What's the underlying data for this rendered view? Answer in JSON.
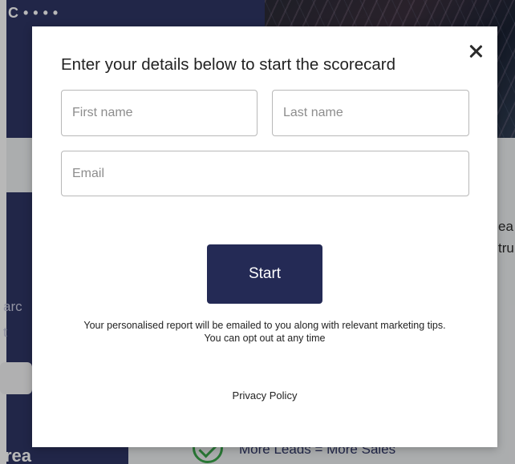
{
  "background": {
    "dots": "C••••",
    "left_fragment_1": "arc",
    "left_fragment_2": "t",
    "right_fragment_1": "ea",
    "right_fragment_2": "tru",
    "brand_fragment": "rea",
    "bullet_text": "More Leads = More Sales"
  },
  "modal": {
    "title": "Enter your details below to start the scorecard",
    "fields": {
      "first_name_placeholder": "First name",
      "last_name_placeholder": "Last name",
      "email_placeholder": "Email"
    },
    "start_label": "Start",
    "notice_line1": "Your personalised report will be emailed to you along with relevant marketing tips.",
    "notice_line2": "You can opt out at any time",
    "privacy_label": "Privacy Policy"
  },
  "colors": {
    "primary_button": "#242a55",
    "background_navy": "#2e3565",
    "check_green": "#3aa64a"
  },
  "icons": {
    "close": "close-icon",
    "check": "check-circle-icon"
  }
}
